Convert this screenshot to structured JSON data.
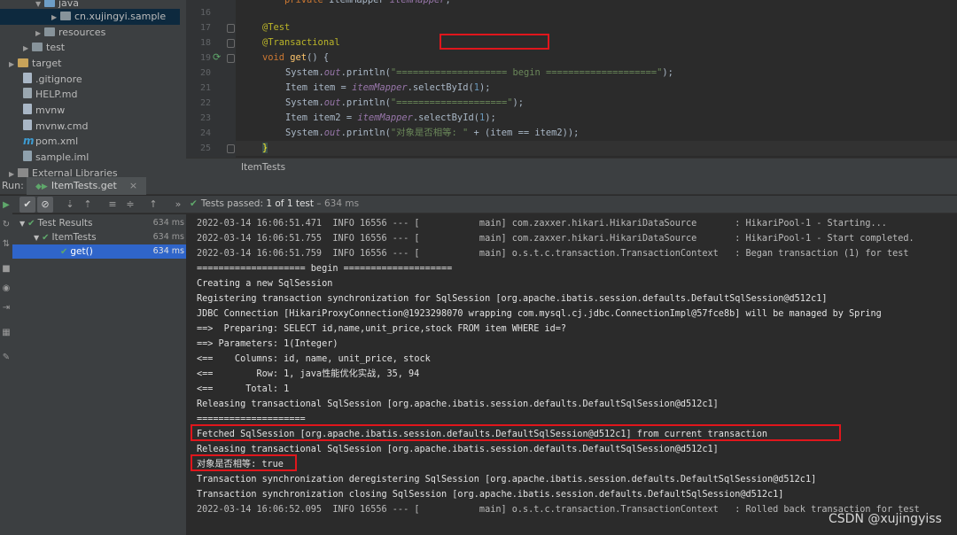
{
  "project_tree": {
    "items": [
      {
        "label": "java",
        "icon": "folder-icon",
        "depth": 3,
        "expanded": true
      },
      {
        "label": "cn.xujingyi.sample",
        "icon": "package-icon",
        "depth": 4,
        "expanded": false,
        "selected": true
      },
      {
        "label": "resources",
        "icon": "folder-icon",
        "depth": 3,
        "expanded": false
      },
      {
        "label": "test",
        "icon": "folder-icon",
        "depth": 2,
        "expanded": false
      },
      {
        "label": "target",
        "icon": "folder-icon",
        "depth": 1,
        "expanded": false
      },
      {
        "label": ".gitignore",
        "icon": "file-icon",
        "depth": 2
      },
      {
        "label": "HELP.md",
        "icon": "markdown-icon",
        "depth": 2
      },
      {
        "label": "mvnw",
        "icon": "file-icon",
        "depth": 2
      },
      {
        "label": "mvnw.cmd",
        "icon": "file-icon",
        "depth": 2
      },
      {
        "label": "pom.xml",
        "icon": "maven-icon",
        "depth": 2
      },
      {
        "label": "sample.iml",
        "icon": "iml-icon",
        "depth": 2
      },
      {
        "label": "External Libraries",
        "icon": "library-icon",
        "depth": 0
      }
    ]
  },
  "editor": {
    "tab_label": "ItemTests",
    "line_numbers": [
      "16",
      "17",
      "18",
      "19",
      "20",
      "21",
      "22",
      "23",
      "24",
      "25"
    ],
    "code": {
      "l16": "    private ItemMapper itemMapper;",
      "l17_ann": "@Test",
      "l18_ann": "@Transactional",
      "l19_kw": "void ",
      "l19_fn": "get",
      "l19_rest": "() {",
      "l20_a": "System.",
      "l20_out": "out",
      "l20_b": ".println(",
      "l20_str": "\"==================== begin ====================\"",
      "l20_c": ");",
      "l21_a": "Item item = ",
      "l21_fld": "itemMapper",
      "l21_b": ".selectById(",
      "l21_num": "1",
      "l21_c": ");",
      "l22_a": "System.",
      "l22_out": "out",
      "l22_b": ".println(",
      "l22_str": "\"====================\"",
      "l22_c": ");",
      "l23_a": "Item item2 = ",
      "l23_fld": "itemMapper",
      "l23_b": ".selectById(",
      "l23_num": "1",
      "l23_c": ");",
      "l24_a": "System.",
      "l24_out": "out",
      "l24_b": ".println(",
      "l24_str": "\"对象是否相等: \"",
      "l24_c": " + (item == item2));",
      "l25": "}"
    }
  },
  "run_panel": {
    "label": "Run:",
    "tab_label": "ItemTests.get",
    "close_glyph": "×",
    "status": "Tests passed:",
    "status_count": "1 of 1 test",
    "status_time": " – 634 ms"
  },
  "test_tree": {
    "rows": [
      {
        "label": "Test Results",
        "duration": "634 ms"
      },
      {
        "label": "ItemTests",
        "duration": "634 ms"
      },
      {
        "label": "get()",
        "duration": "634 ms",
        "selected": true
      }
    ]
  },
  "console": {
    "lines": [
      "2022-03-14 16:06:51.471  INFO 16556 --- [           main] com.zaxxer.hikari.HikariDataSource       : HikariPool-1 - Starting...",
      "2022-03-14 16:06:51.755  INFO 16556 --- [           main] com.zaxxer.hikari.HikariDataSource       : HikariPool-1 - Start completed.",
      "2022-03-14 16:06:51.759  INFO 16556 --- [           main] o.s.t.c.transaction.TransactionContext   : Began transaction (1) for test",
      "==================== begin ====================",
      "Creating a new SqlSession",
      "Registering transaction synchronization for SqlSession [org.apache.ibatis.session.defaults.DefaultSqlSession@d512c1]",
      "JDBC Connection [HikariProxyConnection@1923298070 wrapping com.mysql.cj.jdbc.ConnectionImpl@57fce8b] will be managed by Spring",
      "==>  Preparing: SELECT id,name,unit_price,stock FROM item WHERE id=?",
      "==> Parameters: 1(Integer)",
      "<==    Columns: id, name, unit_price, stock",
      "<==        Row: 1, java性能优化实战, 35, 94",
      "<==      Total: 1",
      "Releasing transactional SqlSession [org.apache.ibatis.session.defaults.DefaultSqlSession@d512c1]",
      "====================",
      "Fetched SqlSession [org.apache.ibatis.session.defaults.DefaultSqlSession@d512c1] from current transaction",
      "Releasing transactional SqlSession [org.apache.ibatis.session.defaults.DefaultSqlSession@d512c1]",
      "对象是否相等: true",
      "Transaction synchronization deregistering SqlSession [org.apache.ibatis.session.defaults.DefaultSqlSession@d512c1]",
      "Transaction synchronization closing SqlSession [org.apache.ibatis.session.defaults.DefaultSqlSession@d512c1]",
      "2022-03-14 16:06:52.095  INFO 16556 --- [           main] o.s.t.c.transaction.TransactionContext   : Rolled back transaction for test"
    ]
  },
  "watermark": "CSDN @xujingyiss",
  "colors": {
    "highlight_box": "#e0161c",
    "pass_green": "#5fa86b",
    "selection_blue": "#2f65ca"
  }
}
